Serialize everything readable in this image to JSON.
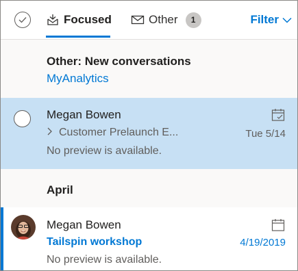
{
  "header": {
    "tabs": [
      {
        "label": "Focused",
        "icon": "inbox-icon",
        "active": true
      },
      {
        "label": "Other",
        "icon": "envelope-icon",
        "badge": "1"
      }
    ],
    "filter_label": "Filter"
  },
  "new_conversations": {
    "title": "Other: New conversations",
    "sender": "MyAnalytics"
  },
  "messages": [
    {
      "sender": "Megan Bowen",
      "subject": "Customer Prelaunch E...",
      "preview": "No preview is available.",
      "date": "Tue 5/14",
      "icon": "calendar-check-icon",
      "selected": true
    },
    {
      "sender": "Megan Bowen",
      "subject": "Tailspin workshop",
      "preview": "No preview is available.",
      "date": "4/19/2019",
      "icon": "calendar-icon",
      "unread": true
    }
  ],
  "group_label": "April",
  "colors": {
    "accent": "#0078d4",
    "selected_row": "#c7e0f4",
    "badge_bg": "#c8c6c4"
  }
}
